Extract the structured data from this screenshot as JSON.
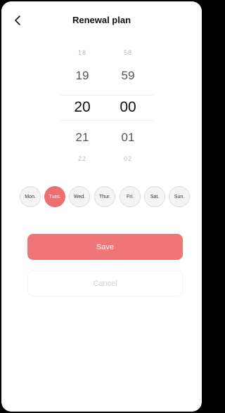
{
  "header": {
    "title": "Renewal plan",
    "back_icon": "chevron-left-icon"
  },
  "picker": {
    "hours": [
      "18",
      "19",
      "20",
      "21",
      "22"
    ],
    "minutes": [
      "58",
      "59",
      "00",
      "01",
      "02"
    ],
    "selected_hour": "20",
    "selected_minute": "00"
  },
  "days": [
    {
      "label": "Mon.",
      "selected": false
    },
    {
      "label": "Tues.",
      "selected": true
    },
    {
      "label": "Wed.",
      "selected": false
    },
    {
      "label": "Thur.",
      "selected": false
    },
    {
      "label": "Fri.",
      "selected": false
    },
    {
      "label": "Sat.",
      "selected": false
    },
    {
      "label": "Sun.",
      "selected": false
    }
  ],
  "actions": {
    "save_label": "Save",
    "cancel_label": "Cancel"
  },
  "colors": {
    "accent": "#f07577"
  }
}
